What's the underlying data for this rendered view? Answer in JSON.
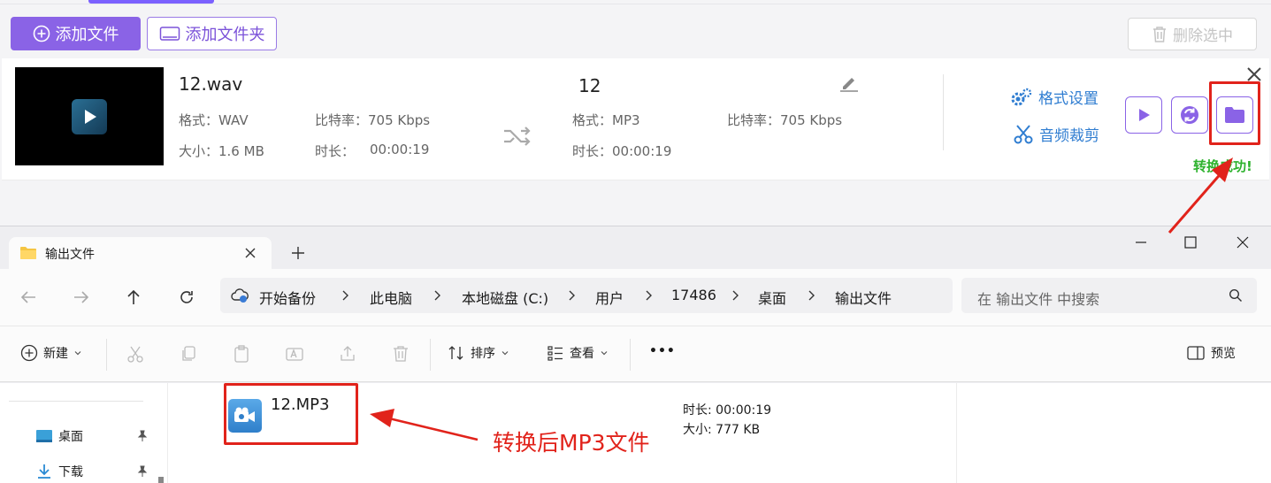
{
  "converter": {
    "add_file_label": "添加文件",
    "add_folder_label": "添加文件夹",
    "delete_selected_label": "删除选中",
    "source": {
      "name": "12.wav",
      "format": "格式：WAV",
      "bitrate": "比特率：705 Kbps",
      "size": "大小：1.6 MB",
      "duration_label": "时长：",
      "duration_value": "00:00:19"
    },
    "output": {
      "name": "12",
      "format": "格式：MP3",
      "bitrate": "比特率：705 Kbps",
      "duration": "时长：00:00:19"
    },
    "format_settings_label": "格式设置",
    "audio_trim_label": "音频裁剪",
    "success_text": "转换成功!"
  },
  "explorer": {
    "tab_title": "输出文件",
    "breadcrumb": [
      "开始备份",
      "此电脑",
      "本地磁盘 (C:)",
      "用户",
      "17486",
      "桌面",
      "输出文件"
    ],
    "search_placeholder": "在 输出文件 中搜索",
    "toolbar": {
      "new_label": "新建",
      "sort_label": "排序",
      "view_label": "查看",
      "more_label": "•••",
      "preview_label": "预览"
    },
    "nav_items": [
      "桌面",
      "下载"
    ],
    "file": {
      "name": "12.MP3",
      "duration": "时长: 00:00:19",
      "size": "大小: 777 KB"
    }
  },
  "annotation": {
    "text": "转换后MP3文件"
  },
  "colors": {
    "accent_purple": "#8a63e6",
    "link_blue": "#2f7dd1",
    "success_green": "#2db22d",
    "annotation_red": "#e1231b"
  }
}
